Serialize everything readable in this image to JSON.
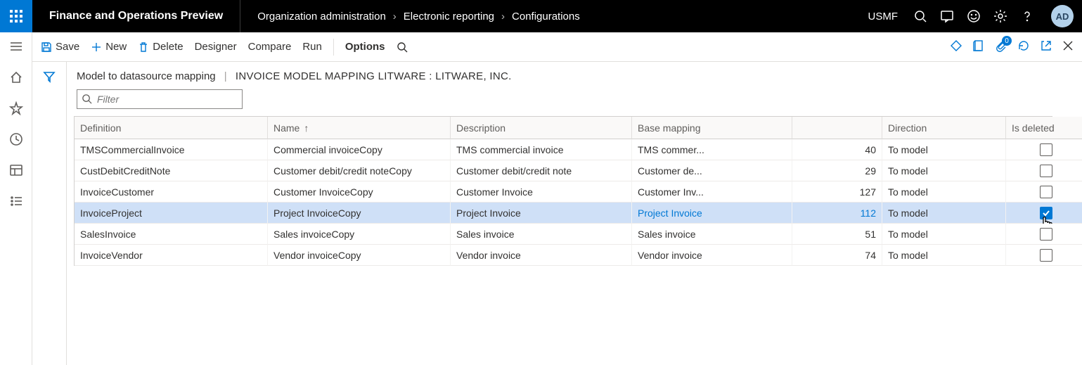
{
  "top": {
    "app_title": "Finance and Operations Preview",
    "breadcrumb": [
      "Organization administration",
      "Electronic reporting",
      "Configurations"
    ],
    "company": "USMF",
    "avatar_initials": "AD"
  },
  "actionbar": {
    "save": "Save",
    "new": "New",
    "delete": "Delete",
    "designer": "Designer",
    "compare": "Compare",
    "run": "Run",
    "options": "Options",
    "attachment_count": "0"
  },
  "page": {
    "title": "Model to datasource mapping",
    "subtitle": "INVOICE MODEL MAPPING LITWARE : LITWARE, INC."
  },
  "filter": {
    "placeholder": "Filter"
  },
  "grid": {
    "headers": {
      "definition": "Definition",
      "name": "Name",
      "description": "Description",
      "base_mapping": "Base mapping",
      "base_mapping_num": "",
      "direction": "Direction",
      "is_deleted": "Is deleted"
    },
    "rows": [
      {
        "definition": "TMSCommercialInvoice",
        "name": "Commercial invoiceCopy",
        "description": "TMS commercial invoice",
        "base": "TMS commer...",
        "num": "40",
        "direction": "To model",
        "deleted": false,
        "selected": false,
        "cursor": false
      },
      {
        "definition": "CustDebitCreditNote",
        "name": "Customer debit/credit noteCopy",
        "description": "Customer debit/credit note",
        "base": "Customer de...",
        "num": "29",
        "direction": "To model",
        "deleted": false,
        "selected": false,
        "cursor": false
      },
      {
        "definition": "InvoiceCustomer",
        "name": "Customer InvoiceCopy",
        "description": "Customer Invoice",
        "base": "Customer Inv...",
        "num": "127",
        "direction": "To model",
        "deleted": false,
        "selected": false,
        "cursor": false
      },
      {
        "definition": "InvoiceProject",
        "name": "Project InvoiceCopy",
        "description": "Project Invoice",
        "base": "Project Invoice",
        "num": "112",
        "direction": "To model",
        "deleted": true,
        "selected": true,
        "cursor": true
      },
      {
        "definition": "SalesInvoice",
        "name": "Sales invoiceCopy",
        "description": "Sales invoice",
        "base": "Sales invoice",
        "num": "51",
        "direction": "To model",
        "deleted": false,
        "selected": false,
        "cursor": false
      },
      {
        "definition": "InvoiceVendor",
        "name": "Vendor invoiceCopy",
        "description": "Vendor invoice",
        "base": "Vendor invoice",
        "num": "74",
        "direction": "To model",
        "deleted": false,
        "selected": false,
        "cursor": false
      }
    ]
  }
}
